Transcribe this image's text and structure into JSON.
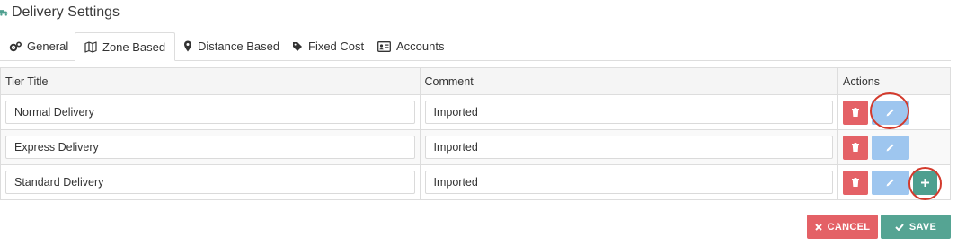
{
  "page": {
    "title": "Delivery Settings"
  },
  "tabs": [
    {
      "label": "General",
      "icon": "gears-icon",
      "active": false
    },
    {
      "label": "Zone Based",
      "icon": "map-icon",
      "active": true
    },
    {
      "label": "Distance Based",
      "icon": "map-marker-icon",
      "active": false
    },
    {
      "label": "Fixed Cost",
      "icon": "tag-icon",
      "active": false
    },
    {
      "label": "Accounts",
      "icon": "id-card-icon",
      "active": false
    }
  ],
  "table": {
    "headers": {
      "tier_title": "Tier Title",
      "comment": "Comment",
      "actions": "Actions"
    },
    "rows": [
      {
        "tier_title": "Normal Delivery",
        "comment": "Imported"
      },
      {
        "tier_title": "Express Delivery",
        "comment": "Imported"
      },
      {
        "tier_title": "Standard Delivery",
        "comment": "Imported"
      }
    ]
  },
  "footer": {
    "cancel_label": "CANCEL",
    "save_label": "SAVE"
  },
  "colors": {
    "delete": "#e46166",
    "edit": "#9ec6ef",
    "add": "#4e9f8f",
    "save": "#55a493",
    "cancel": "#e46166",
    "annotation": "#d33a2c"
  }
}
